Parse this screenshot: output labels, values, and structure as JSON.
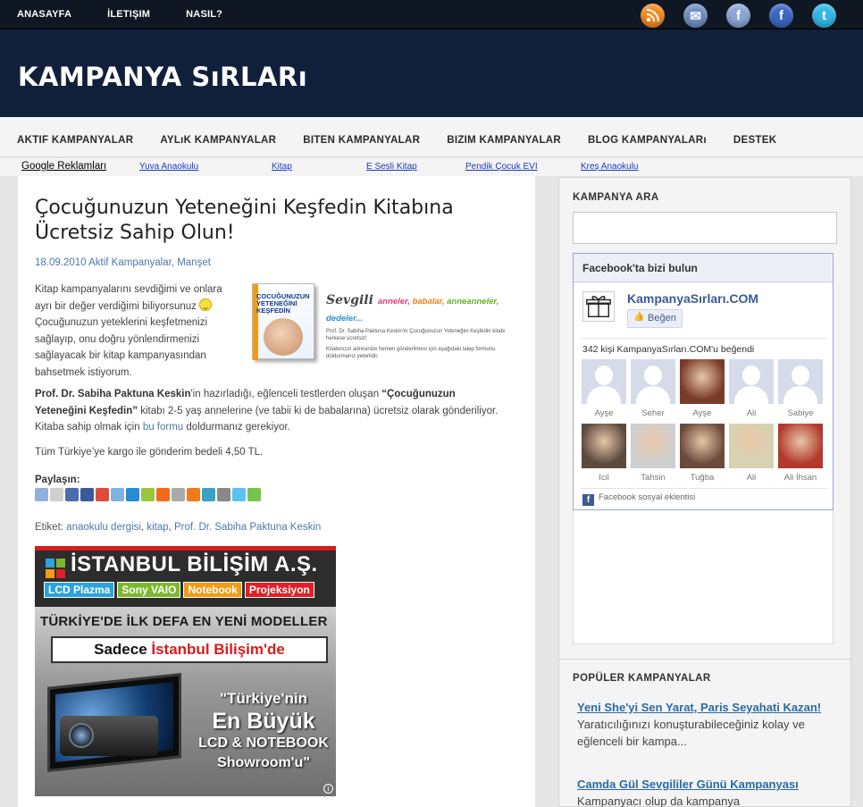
{
  "topnav": [
    "ANASAYFA",
    "İLETIŞIM",
    "NASIL?"
  ],
  "social_icons": [
    {
      "name": "rss-icon",
      "color": "#f28a1f",
      "glyph": ""
    },
    {
      "name": "mail-icon",
      "color": "#6f8fc3",
      "glyph": "✉"
    },
    {
      "name": "friendfeed-icon",
      "color": "#8aa6d8",
      "glyph": "f"
    },
    {
      "name": "facebook-icon",
      "color": "#3b67c4",
      "glyph": "f"
    },
    {
      "name": "twitter-icon",
      "color": "#35b5e8",
      "glyph": "t"
    }
  ],
  "site_title": "KAMPANYA SıRLARı",
  "mainnav": [
    "AKTIF KAMPANYALAR",
    "AYLıK KAMPANYALAR",
    "BITEN KAMPANYALAR",
    "BIZIM KAMPANYALAR",
    "BLOG KAMPANYALARı",
    "DESTEK"
  ],
  "ads": {
    "label": "Google Reklamları",
    "links": [
      "Yuva Anaokulu",
      "Kitap",
      "E Sesli Kitap",
      "Pendik Çocuk EVI",
      "Kreş Anaokulu"
    ]
  },
  "post": {
    "title": "Çocuğunuzun Yeteneğini Keşfedin Kitabına Ücretsiz Sahip Olun!",
    "date": "18.09.2010",
    "categories": [
      "Aktif Kampanyalar",
      "Manşet"
    ],
    "intro_a": "Kitap kampanyalarını sevdiğimi ve onlara ayrı bir değer verdiğimi biliyorsunuz ",
    "intro_b": "Çocuğunuzun yeteklerini keşfetmenizi sağlayıp, onu doğru yönlendirmenizi sağlayacak bir kitap kampanyasından bahsetmek istiyorum.",
    "book": {
      "cover_title": "ÇOCUĞUNUZUN YETENEĞİNİ KEŞFEDİN",
      "sevgili": "Sevgili",
      "audience": [
        "anneler,",
        "babalar,",
        "anneanneler,",
        "dedeler..."
      ],
      "note1": "Prof. Dr. Sabiha Paktuna Keskin'in Çocuğunuzun Yeteneğini Keşfedin kitabı herkese ücretsiz!",
      "note2": "Kitabınızın adresinize hemen gönderilmesi için aşağıdaki talep formunu doldurmanız yeterlidir."
    },
    "p2_author": "Prof. Dr. Sabiha Paktuna Keskin",
    "p2_a": "'in hazırladığı, eğlenceli testlerden oluşan ",
    "p2_book": "“Çocuğunuzun Yeteneğini Keşfedin”",
    "p2_b": " kitabı 2-5 yaş annelerine (ve tabii ki de babalarına) ücretsiz olarak gönderiliyor. Kitaba sahip olmak için ",
    "p2_link": "bu formu",
    "p2_c": " doldurmanız gerekiyor.",
    "p3": "Tüm Türkiye’ye kargo ile gönderim bedeli 4,50 TL.",
    "share_label": "Paylaşın:",
    "share_colors": [
      "#8fb0dc",
      "#cfcfcf",
      "#4d6bb0",
      "#3b5998",
      "#dd4b39",
      "#7fb3e3",
      "#2a8ad4",
      "#9bc53d",
      "#f26b1d",
      "#aaa",
      "#f07b1d",
      "#3aa0c6",
      "#888",
      "#59c3ee",
      "#78c34c"
    ],
    "tags_label": "Etiket:",
    "tags": [
      "anaokulu dergisi",
      "kitap",
      "Prof. Dr. Sabiha Paktuna Keskin"
    ]
  },
  "banner": {
    "brand": "İSTANBUL BİLİŞİM A.Ş.",
    "categories": [
      {
        "label": "LCD Plazma",
        "color": "#2ba3dc"
      },
      {
        "label": "Sony VAIO",
        "color": "#7cb82f"
      },
      {
        "label": "Notebook",
        "color": "#f39b14"
      },
      {
        "label": "Projeksiyon",
        "color": "#e11f27"
      }
    ],
    "headline": "TÜRKİYE'DE İLK DEFA EN YENİ MODELLER",
    "only_a": "Sadece ",
    "only_b": "İstanbul Bilişim'de",
    "big1": "\"Türkiye'nin",
    "big2": "En Büyük",
    "big3": "LCD & NOTEBOOK",
    "big4": "Showroom'u\""
  },
  "sidebar": {
    "search_title": "KAMPANYA ARA",
    "search_value": "",
    "facebook": {
      "header": "Facebook'ta bizi bulun",
      "page_name": "KampanyaSırları.COM",
      "like": "Beğen",
      "count_text": "342 kişi KampanyaSırları.COM'u beğendi",
      "fans": [
        {
          "name": "Ayşe",
          "photo": false,
          "tone": ""
        },
        {
          "name": "Seher",
          "photo": false,
          "tone": ""
        },
        {
          "name": "Ayşe",
          "photo": true,
          "tone": "#7a3b2a"
        },
        {
          "name": "Ali",
          "photo": false,
          "tone": ""
        },
        {
          "name": "Sabiye",
          "photo": false,
          "tone": ""
        },
        {
          "name": "Icil",
          "photo": true,
          "tone": "#5b4a3e"
        },
        {
          "name": "Tahsin",
          "photo": true,
          "tone": "#cfcfcf"
        },
        {
          "name": "Tuğba",
          "photo": true,
          "tone": "#6b4a3a"
        },
        {
          "name": "Ali",
          "photo": true,
          "tone": "#d8d2b4"
        },
        {
          "name": "Ali İhsan",
          "photo": true,
          "tone": "#b23a2c"
        }
      ],
      "plugin_label": "Facebook sosyal eklentisi"
    },
    "popular_title": "POPÜLER KAMPANYALAR",
    "popular": [
      {
        "title": "Yeni She'yi Sen Yarat, Paris Seyahati Kazan!",
        "desc": "Yaratıcılığınızı konuşturabileceğiniz kolay ve eğlenceli bir kampa..."
      },
      {
        "title": "Camda Gül Sevgililer Günü Kampanyası",
        "desc": "Kampanyacı olup da kampanya"
      }
    ]
  }
}
